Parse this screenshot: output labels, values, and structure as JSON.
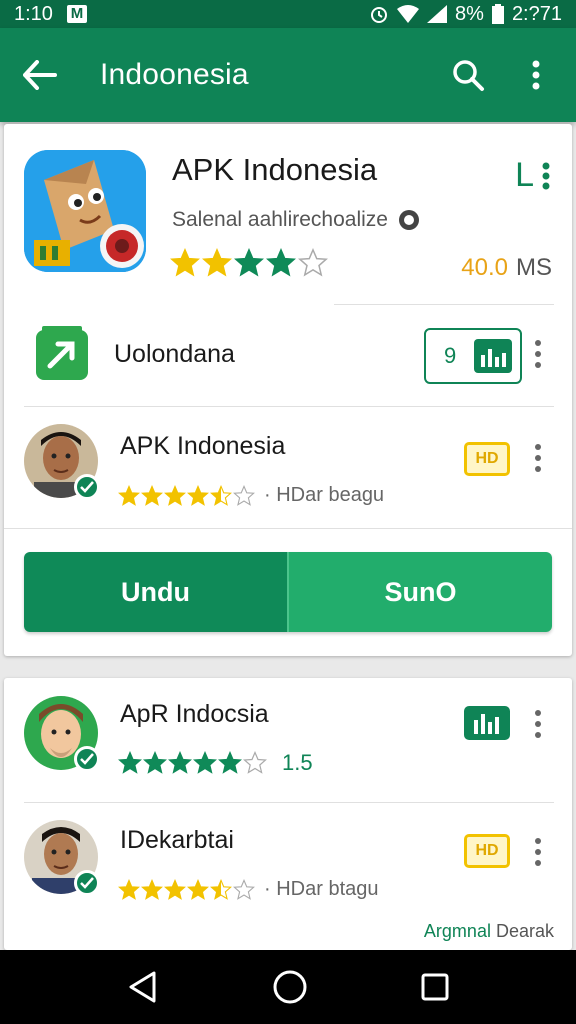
{
  "status_bar": {
    "time": "1:10",
    "battery": "8%",
    "clock": "2:?71"
  },
  "app_bar": {
    "title": "Indoonesia"
  },
  "app": {
    "name": "APK Indonesia",
    "subtitle": "Salenal aahlirechoalize",
    "rating": 4,
    "rating_max": 5,
    "size_value": "40.0",
    "size_unit": "MS",
    "menu_letter": "L"
  },
  "rows": [
    {
      "label": "Uolondana",
      "badge_count": "9"
    },
    {
      "label": "APK Indonesia",
      "rating": 4.5,
      "meta": "· HDar beagu"
    }
  ],
  "buttons": {
    "primary": "Undu",
    "secondary": "SunO"
  },
  "list2": [
    {
      "label": "ApR Indocsia",
      "rating": 5,
      "meta": "1.5"
    },
    {
      "label": "IDekarbtai",
      "rating": 4.5,
      "meta": "· HDar btagu"
    }
  ],
  "footer": {
    "link_a": "Argmnal",
    "link_b": "Dearak"
  },
  "colors": {
    "primary": "#0f8456",
    "status": "#0a6b45",
    "star_yellow": "#f2c200",
    "star_green": "#0f8a58",
    "size_orange": "#e8a317"
  }
}
